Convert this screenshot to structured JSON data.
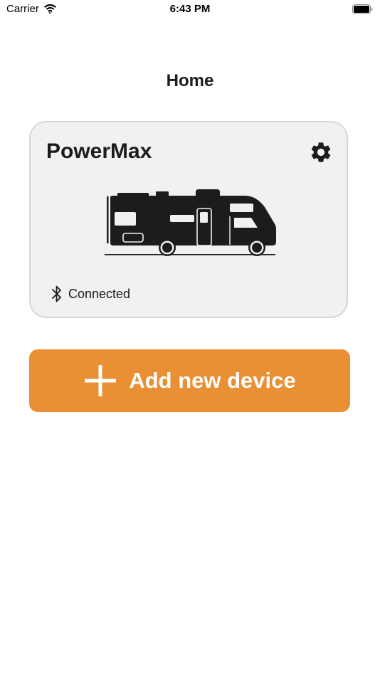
{
  "status_bar": {
    "carrier": "Carrier",
    "time": "6:43 PM",
    "wifi_icon": "wifi-icon",
    "battery_icon": "battery-full-icon"
  },
  "header": {
    "title": "Home"
  },
  "device_card": {
    "name": "PowerMax",
    "settings_icon": "gear-icon",
    "image": "rv-motorhome-silhouette",
    "status_icon": "bluetooth-icon",
    "status": "Connected"
  },
  "add_device": {
    "icon": "plus-icon",
    "label": "Add new device"
  },
  "colors": {
    "accent": "#e98f34",
    "card_background": "#f0f1f1",
    "card_border": "#d6d7d8",
    "text": "#1c1c1e"
  }
}
